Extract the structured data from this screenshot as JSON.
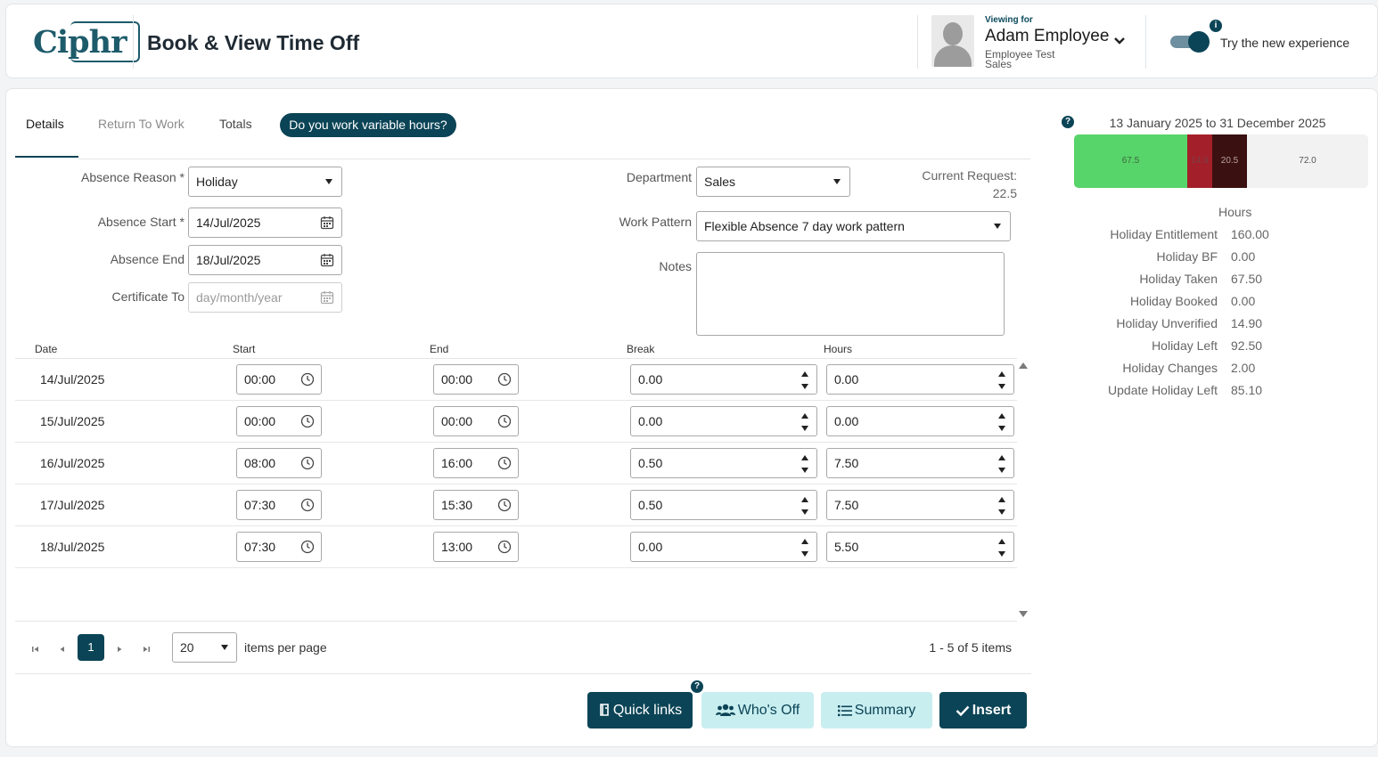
{
  "header": {
    "logo": "Ciphr",
    "title": "Book & View Time Off",
    "viewing_for_label": "Viewing for",
    "employee_name": "Adam Employee",
    "employee_sub1": "Employee Test",
    "employee_sub2": "Sales",
    "toggle_label": "Try the new experience",
    "info_icon": "i"
  },
  "tabs": [
    {
      "label": "Details"
    },
    {
      "label": "Return To Work"
    },
    {
      "label": "Totals"
    }
  ],
  "variable_hours_button": "Do you work variable hours?",
  "form": {
    "absence_reason_label": "Absence Reason *",
    "absence_reason_value": "Holiday",
    "absence_start_label": "Absence Start *",
    "absence_start_value": "14/Jul/2025",
    "absence_end_label": "Absence End",
    "absence_end_value": "18/Jul/2025",
    "certificate_to_label": "Certificate To",
    "certificate_to_placeholder": "day/month/year",
    "department_label": "Department",
    "department_value": "Sales",
    "work_pattern_label": "Work Pattern",
    "work_pattern_value": "Flexible Absence 7 day work pattern",
    "notes_label": "Notes",
    "current_request_label": "Current Request:",
    "current_request_value": "22.5"
  },
  "grid": {
    "columns": [
      "Date",
      "Start",
      "End",
      "Break",
      "Hours"
    ],
    "rows": [
      {
        "date": "14/Jul/2025",
        "start": "00:00",
        "end": "00:00",
        "break": "0.00",
        "hours": "0.00"
      },
      {
        "date": "15/Jul/2025",
        "start": "00:00",
        "end": "00:00",
        "break": "0.00",
        "hours": "0.00"
      },
      {
        "date": "16/Jul/2025",
        "start": "08:00",
        "end": "16:00",
        "break": "0.50",
        "hours": "7.50"
      },
      {
        "date": "17/Jul/2025",
        "start": "07:30",
        "end": "15:30",
        "break": "0.50",
        "hours": "7.50"
      },
      {
        "date": "18/Jul/2025",
        "start": "07:30",
        "end": "13:00",
        "break": "0.00",
        "hours": "5.50"
      }
    ]
  },
  "pager": {
    "current_page": "1",
    "page_size": "20",
    "items_per_page_label": "items per page",
    "info": "1 - 5 of 5 items"
  },
  "buttons": {
    "quick_links": "Quick links",
    "whos_off": "Who's Off",
    "summary": "Summary",
    "insert": "Insert",
    "help": "?"
  },
  "summary_panel": {
    "help": "?",
    "date_range": "13 January 2025 to 31 December 2025",
    "bar_segments": [
      {
        "label": "67.5",
        "value": 67.5,
        "color": "#57d46a",
        "text_color": "#3d6a3f"
      },
      {
        "label": "14.9",
        "value": 14.9,
        "color": "#a3202a",
        "text_color": "#7a4046"
      },
      {
        "label": "20.5",
        "value": 20.5,
        "color": "#3a1010",
        "text_color": "#b8a0a0"
      },
      {
        "label": "72.0",
        "value": 72.0,
        "color": "#f2f2f2",
        "text_color": "#555555"
      }
    ],
    "hours_header": "Hours",
    "stats": [
      {
        "label": "Holiday Entitlement",
        "value": "160.00"
      },
      {
        "label": "Holiday BF",
        "value": "0.00"
      },
      {
        "label": "Holiday Taken",
        "value": "67.50"
      },
      {
        "label": "Holiday Booked",
        "value": "0.00"
      },
      {
        "label": "Holiday Unverified",
        "value": "14.90"
      },
      {
        "label": "Holiday Left",
        "value": "92.50"
      },
      {
        "label": "Holiday Changes",
        "value": "2.00"
      },
      {
        "label": "Update Holiday Left",
        "value": "85.10"
      }
    ]
  },
  "colors": {
    "accent": "#0b4456",
    "accent_light": "#c9eef0"
  }
}
